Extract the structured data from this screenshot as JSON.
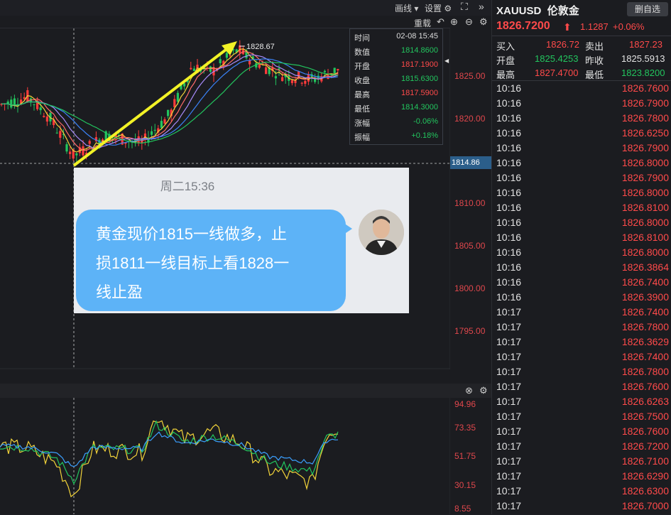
{
  "toolbar": {
    "draw_label": "画线",
    "settings_label": "设置",
    "reload_label": "重载"
  },
  "price_axis": [
    "1825.00",
    "1820.00",
    "1810.00",
    "1805.00",
    "1800.00",
    "1795.00"
  ],
  "crosshair_price": "1814.86",
  "peak_label": "1828.67",
  "tooltip": {
    "rows": [
      {
        "k": "时间",
        "v": "02-08 15:45",
        "color": "#dcdcdc"
      },
      {
        "k": "数值",
        "v": "1814.8600",
        "color": "#22c55e"
      },
      {
        "k": "开盘",
        "v": "1817.1900",
        "color": "#ff4a4a"
      },
      {
        "k": "收盘",
        "v": "1815.6300",
        "color": "#22c55e"
      },
      {
        "k": "最高",
        "v": "1817.5900",
        "color": "#ff4a4a"
      },
      {
        "k": "最低",
        "v": "1814.3000",
        "color": "#22c55e"
      },
      {
        "k": "涨幅",
        "v": "-0.06%",
        "color": "#22c55e"
      },
      {
        "k": "振幅",
        "v": "+0.18%",
        "color": "#22c55e"
      }
    ]
  },
  "chat": {
    "time": "周二15:36",
    "line1": "黄金现价1815一线做多，止",
    "line2": "损1811一线目标上看1828一",
    "line3": "线止盈"
  },
  "indicator_axis": [
    "94.96",
    "73.35",
    "51.75",
    "30.15",
    "8.55"
  ],
  "side": {
    "symbol": "XAUUSD",
    "name": "伦敦金",
    "delete_btn": "删自选",
    "price": "1826.7200",
    "change": "1.1287",
    "change_pct": "+0.06%",
    "buy_label": "买入",
    "buy": "1826.72",
    "sell_label": "卖出",
    "sell": "1827.23",
    "open_label": "开盘",
    "open": "1825.4253",
    "prev_label": "昨收",
    "prev": "1825.5913",
    "high_label": "最高",
    "high": "1827.4700",
    "low_label": "最低",
    "low": "1823.8200"
  },
  "ticks": [
    {
      "t": "10:16",
      "p": "1826.7600"
    },
    {
      "t": "10:16",
      "p": "1826.7900"
    },
    {
      "t": "10:16",
      "p": "1826.7800"
    },
    {
      "t": "10:16",
      "p": "1826.6250"
    },
    {
      "t": "10:16",
      "p": "1826.7900"
    },
    {
      "t": "10:16",
      "p": "1826.8000"
    },
    {
      "t": "10:16",
      "p": "1826.7900"
    },
    {
      "t": "10:16",
      "p": "1826.8000"
    },
    {
      "t": "10:16",
      "p": "1826.8100"
    },
    {
      "t": "10:16",
      "p": "1826.8000"
    },
    {
      "t": "10:16",
      "p": "1826.8100"
    },
    {
      "t": "10:16",
      "p": "1826.8000"
    },
    {
      "t": "10:16",
      "p": "1826.3864"
    },
    {
      "t": "10:16",
      "p": "1826.7400"
    },
    {
      "t": "10:16",
      "p": "1826.3900"
    },
    {
      "t": "10:17",
      "p": "1826.7400"
    },
    {
      "t": "10:17",
      "p": "1826.7800"
    },
    {
      "t": "10:17",
      "p": "1826.3629"
    },
    {
      "t": "10:17",
      "p": "1826.7400"
    },
    {
      "t": "10:17",
      "p": "1826.7800"
    },
    {
      "t": "10:17",
      "p": "1826.7600"
    },
    {
      "t": "10:17",
      "p": "1826.6263"
    },
    {
      "t": "10:17",
      "p": "1826.7500"
    },
    {
      "t": "10:17",
      "p": "1826.7600"
    },
    {
      "t": "10:17",
      "p": "1826.7200"
    },
    {
      "t": "10:17",
      "p": "1826.7100"
    },
    {
      "t": "10:17",
      "p": "1826.6290"
    },
    {
      "t": "10:17",
      "p": "1826.6300"
    },
    {
      "t": "10:17",
      "p": "1826.7000"
    }
  ]
}
